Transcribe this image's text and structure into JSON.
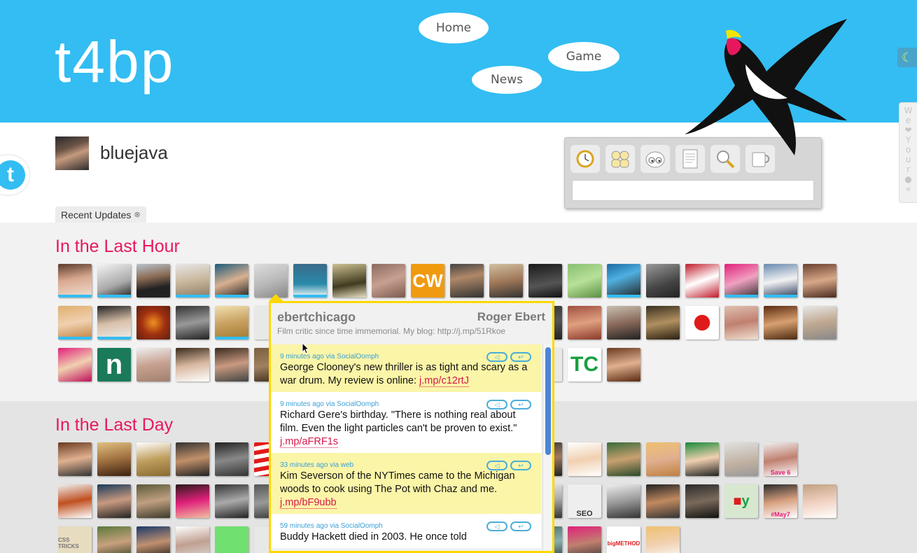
{
  "brand": {
    "logo": "t4bp"
  },
  "nav": [
    {
      "label": "Home"
    },
    {
      "label": "Game"
    },
    {
      "label": "News"
    }
  ],
  "user": {
    "name": "bluejava"
  },
  "toolbar": {
    "tools": [
      {
        "icon": "watch-icon"
      },
      {
        "icon": "friends-icon"
      },
      {
        "icon": "eyes-icon"
      },
      {
        "icon": "notepad-icon"
      },
      {
        "icon": "magnifier-icon"
      },
      {
        "icon": "mug-icon"
      }
    ],
    "input_value": ""
  },
  "side_strip": {
    "letters": [
      "W",
      "e",
      "Y",
      "o",
      "u",
      "r",
      "«"
    ]
  },
  "recent_tab": {
    "label": "Recent Updates",
    "close": "⊗"
  },
  "sections": {
    "hour": {
      "title": "In the Last Hour"
    },
    "day": {
      "title": "In the Last Day"
    }
  },
  "popup": {
    "screen_name": "ebertchicago",
    "full_name": "Roger Ebert",
    "bio": "Film critic since time immemorial. My blog: http://j.mp/51Rkoe",
    "tweets": [
      {
        "meta": "9 minutes ago via SocialOomph",
        "text": "George Clooney's new thriller is as tight and scary as a war drum. My review is online: ",
        "link": "j.mp/c12rtJ"
      },
      {
        "meta": "9 minutes ago via SocialOomph",
        "text": "Richard Gere's birthday. \"There is nothing real about film. Even the light particles can't be proven to exist.\" ",
        "link": "j.mp/aFRF1s"
      },
      {
        "meta": "33 minutes ago via web",
        "text": "Kim Severson of the NYTimes came to the Michigan woods to cook using The Pot with Chaz and me. ",
        "link": "j.mp/bF9ubb"
      },
      {
        "meta": "59 minutes ago via SocialOomph",
        "text": "Buddy Hackett died in 2003. He once told",
        "link": ""
      }
    ]
  },
  "colors": {
    "header_bg": "#33bdf2",
    "accent_title": "#e8175d",
    "popup_border": "#fcd800",
    "tweet_highlight": "#fbf5a8",
    "link": "#d6174b",
    "meta": "#3a9fd6"
  },
  "avatar_text": {
    "cw": "CW",
    "n": "n",
    "tc": "TC",
    "seo": "SEO",
    "big": "bigMETHOD",
    "css": "CSS TRICKS",
    "save": "Save 6",
    "may7": "#May7"
  }
}
